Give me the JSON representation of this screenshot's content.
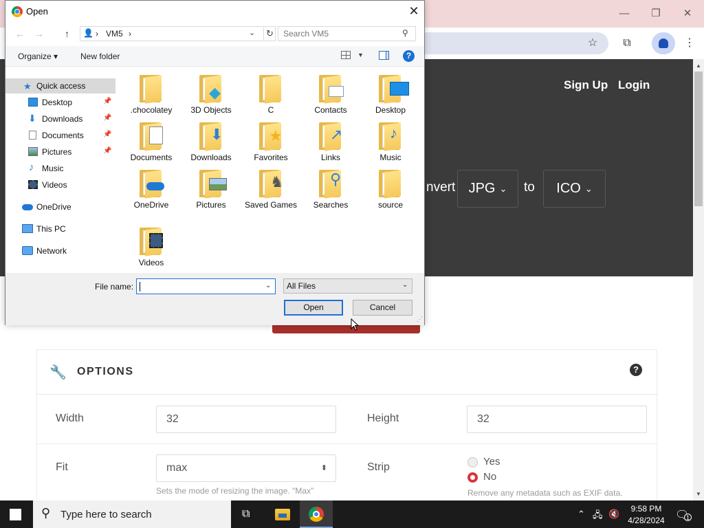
{
  "dialog": {
    "title": "Open",
    "address": {
      "root": "›",
      "path": "VM5",
      "sep": "›"
    },
    "search_placeholder": "Search VM5",
    "organize_label": "Organize",
    "new_folder_label": "New folder",
    "help_glyph": "?",
    "nav_items": [
      {
        "label": "Quick access",
        "icon": "quick-access-star-icon",
        "pinned": false
      },
      {
        "label": "Desktop",
        "icon": "desktop-icon",
        "pinned": true
      },
      {
        "label": "Downloads",
        "icon": "downloads-icon",
        "pinned": true
      },
      {
        "label": "Documents",
        "icon": "documents-icon",
        "pinned": true
      },
      {
        "label": "Pictures",
        "icon": "pictures-icon",
        "pinned": true
      },
      {
        "label": "Music",
        "icon": "music-icon",
        "pinned": false
      },
      {
        "label": "Videos",
        "icon": "videos-icon",
        "pinned": false
      },
      {
        "label": "OneDrive",
        "icon": "onedrive-icon",
        "pinned": false
      },
      {
        "label": "This PC",
        "icon": "this-pc-icon",
        "pinned": false
      },
      {
        "label": "Network",
        "icon": "network-icon",
        "pinned": false
      }
    ],
    "files": [
      {
        "label": ".chocolatey",
        "badge": ""
      },
      {
        "label": "3D Objects",
        "badge": "cube"
      },
      {
        "label": "C",
        "badge": ""
      },
      {
        "label": "Contacts",
        "badge": "contact-card"
      },
      {
        "label": "Desktop",
        "badge": "monitor"
      },
      {
        "label": "Documents",
        "badge": "document"
      },
      {
        "label": "Downloads",
        "badge": "down-arrow"
      },
      {
        "label": "Favorites",
        "badge": "star"
      },
      {
        "label": "Links",
        "badge": "link-arrow"
      },
      {
        "label": "Music",
        "badge": "music-note"
      },
      {
        "label": "OneDrive",
        "badge": "cloud"
      },
      {
        "label": "Pictures",
        "badge": "landscape"
      },
      {
        "label": "Saved Games",
        "badge": "chess-piece"
      },
      {
        "label": "Searches",
        "badge": "magnifier"
      },
      {
        "label": "source",
        "badge": ""
      },
      {
        "label": "Videos",
        "badge": "film"
      }
    ],
    "file_name_label": "File name:",
    "file_name_value": "",
    "file_type_value": "All Files",
    "open_button": "Open",
    "cancel_button": "Cancel"
  },
  "page": {
    "nav": {
      "signup": "Sign Up",
      "login": "Login"
    },
    "convert_word": "nvert",
    "from_format": "JPG",
    "to_word": "to",
    "to_format": "ICO",
    "options": {
      "title": "OPTIONS",
      "help_glyph": "?",
      "width_label": "Width",
      "width_value": "32",
      "height_label": "Height",
      "height_value": "32",
      "fit_label": "Fit",
      "fit_value": "max",
      "fit_hint": "Sets the mode of resizing the image. \"Max\"",
      "strip_label": "Strip",
      "strip_options": [
        "Yes",
        "No"
      ],
      "strip_selected": "No",
      "strip_hint": "Remove any metadata such as EXIF data."
    }
  },
  "taskbar": {
    "search_placeholder": "Type here to search",
    "time": "9:58 PM",
    "date": "4/28/2024",
    "notification_count": "1"
  },
  "colors": {
    "hero_bg": "#3b3b3b",
    "accent_red": "#d9343b",
    "dialog_selection": "#1e6fd9"
  }
}
